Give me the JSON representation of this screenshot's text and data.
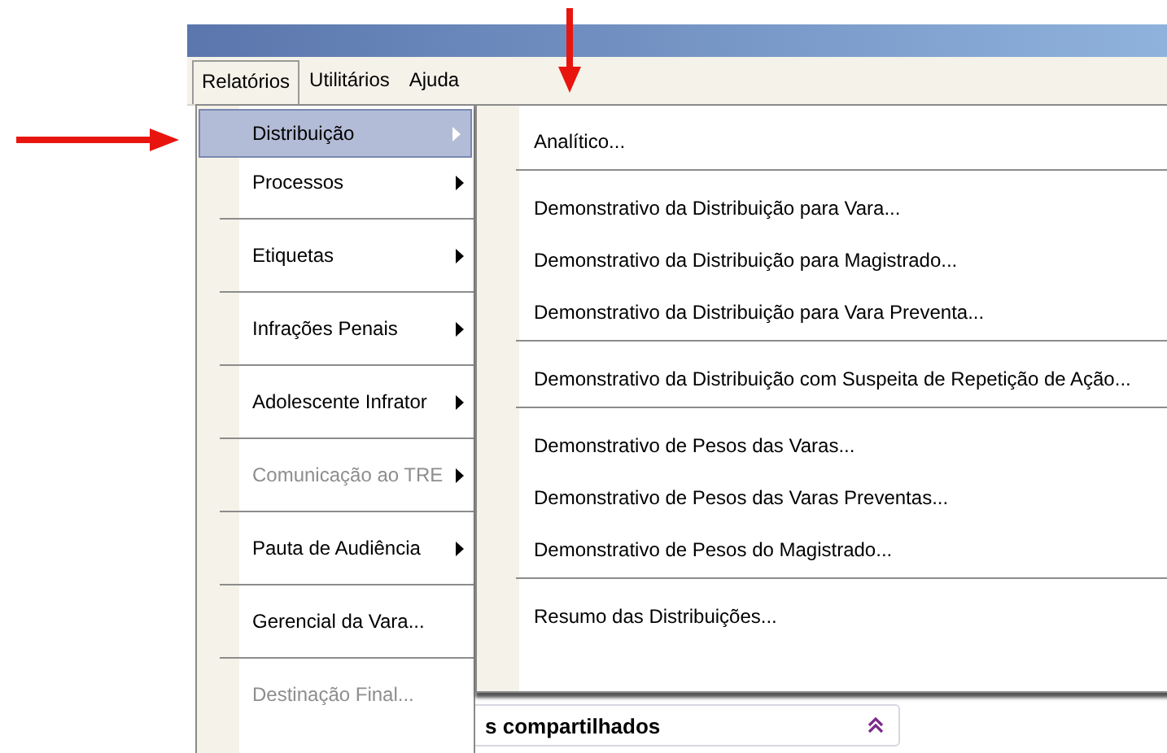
{
  "menubar": [
    {
      "label": "Relatórios",
      "selected": true
    },
    {
      "label": "Utilitários",
      "selected": false
    },
    {
      "label": "Ajuda",
      "selected": false
    }
  ],
  "menu": {
    "groups": [
      [
        {
          "label": "Distribuição",
          "submenu": true,
          "disabled": false,
          "selected": true
        },
        {
          "label": "Processos",
          "submenu": true,
          "disabled": false,
          "selected": false
        }
      ],
      [
        {
          "label": "Etiquetas",
          "submenu": true,
          "disabled": false,
          "selected": false
        }
      ],
      [
        {
          "label": "Infrações Penais",
          "submenu": true,
          "disabled": false,
          "selected": false
        }
      ],
      [
        {
          "label": "Adolescente Infrator",
          "submenu": true,
          "disabled": false,
          "selected": false
        }
      ],
      [
        {
          "label": "Comunicação ao TRE",
          "submenu": true,
          "disabled": true,
          "selected": false
        }
      ],
      [
        {
          "label": "Pauta de Audiência",
          "submenu": true,
          "disabled": false,
          "selected": false
        }
      ],
      [
        {
          "label": "Gerencial da Vara...",
          "submenu": false,
          "disabled": false,
          "selected": false
        }
      ],
      [
        {
          "label": "Destinação Final...",
          "submenu": false,
          "disabled": true,
          "selected": false
        }
      ]
    ]
  },
  "submenu": {
    "groups": [
      [
        "Analítico..."
      ],
      [
        "Demonstrativo da Distribuição para Vara...",
        "Demonstrativo da Distribuição para Magistrado...",
        "Demonstrativo da Distribuição para Vara Preventa..."
      ],
      [
        "Demonstrativo da Distribuição com Suspeita de Repetição de Ação..."
      ],
      [
        "Demonstrativo de Pesos das Varas...",
        "Demonstrativo de Pesos das Varas Preventas...",
        "Demonstrativo de Pesos do Magistrado..."
      ],
      [
        "Resumo das Distribuições..."
      ]
    ]
  },
  "panel": {
    "title": "s compartilhados"
  }
}
